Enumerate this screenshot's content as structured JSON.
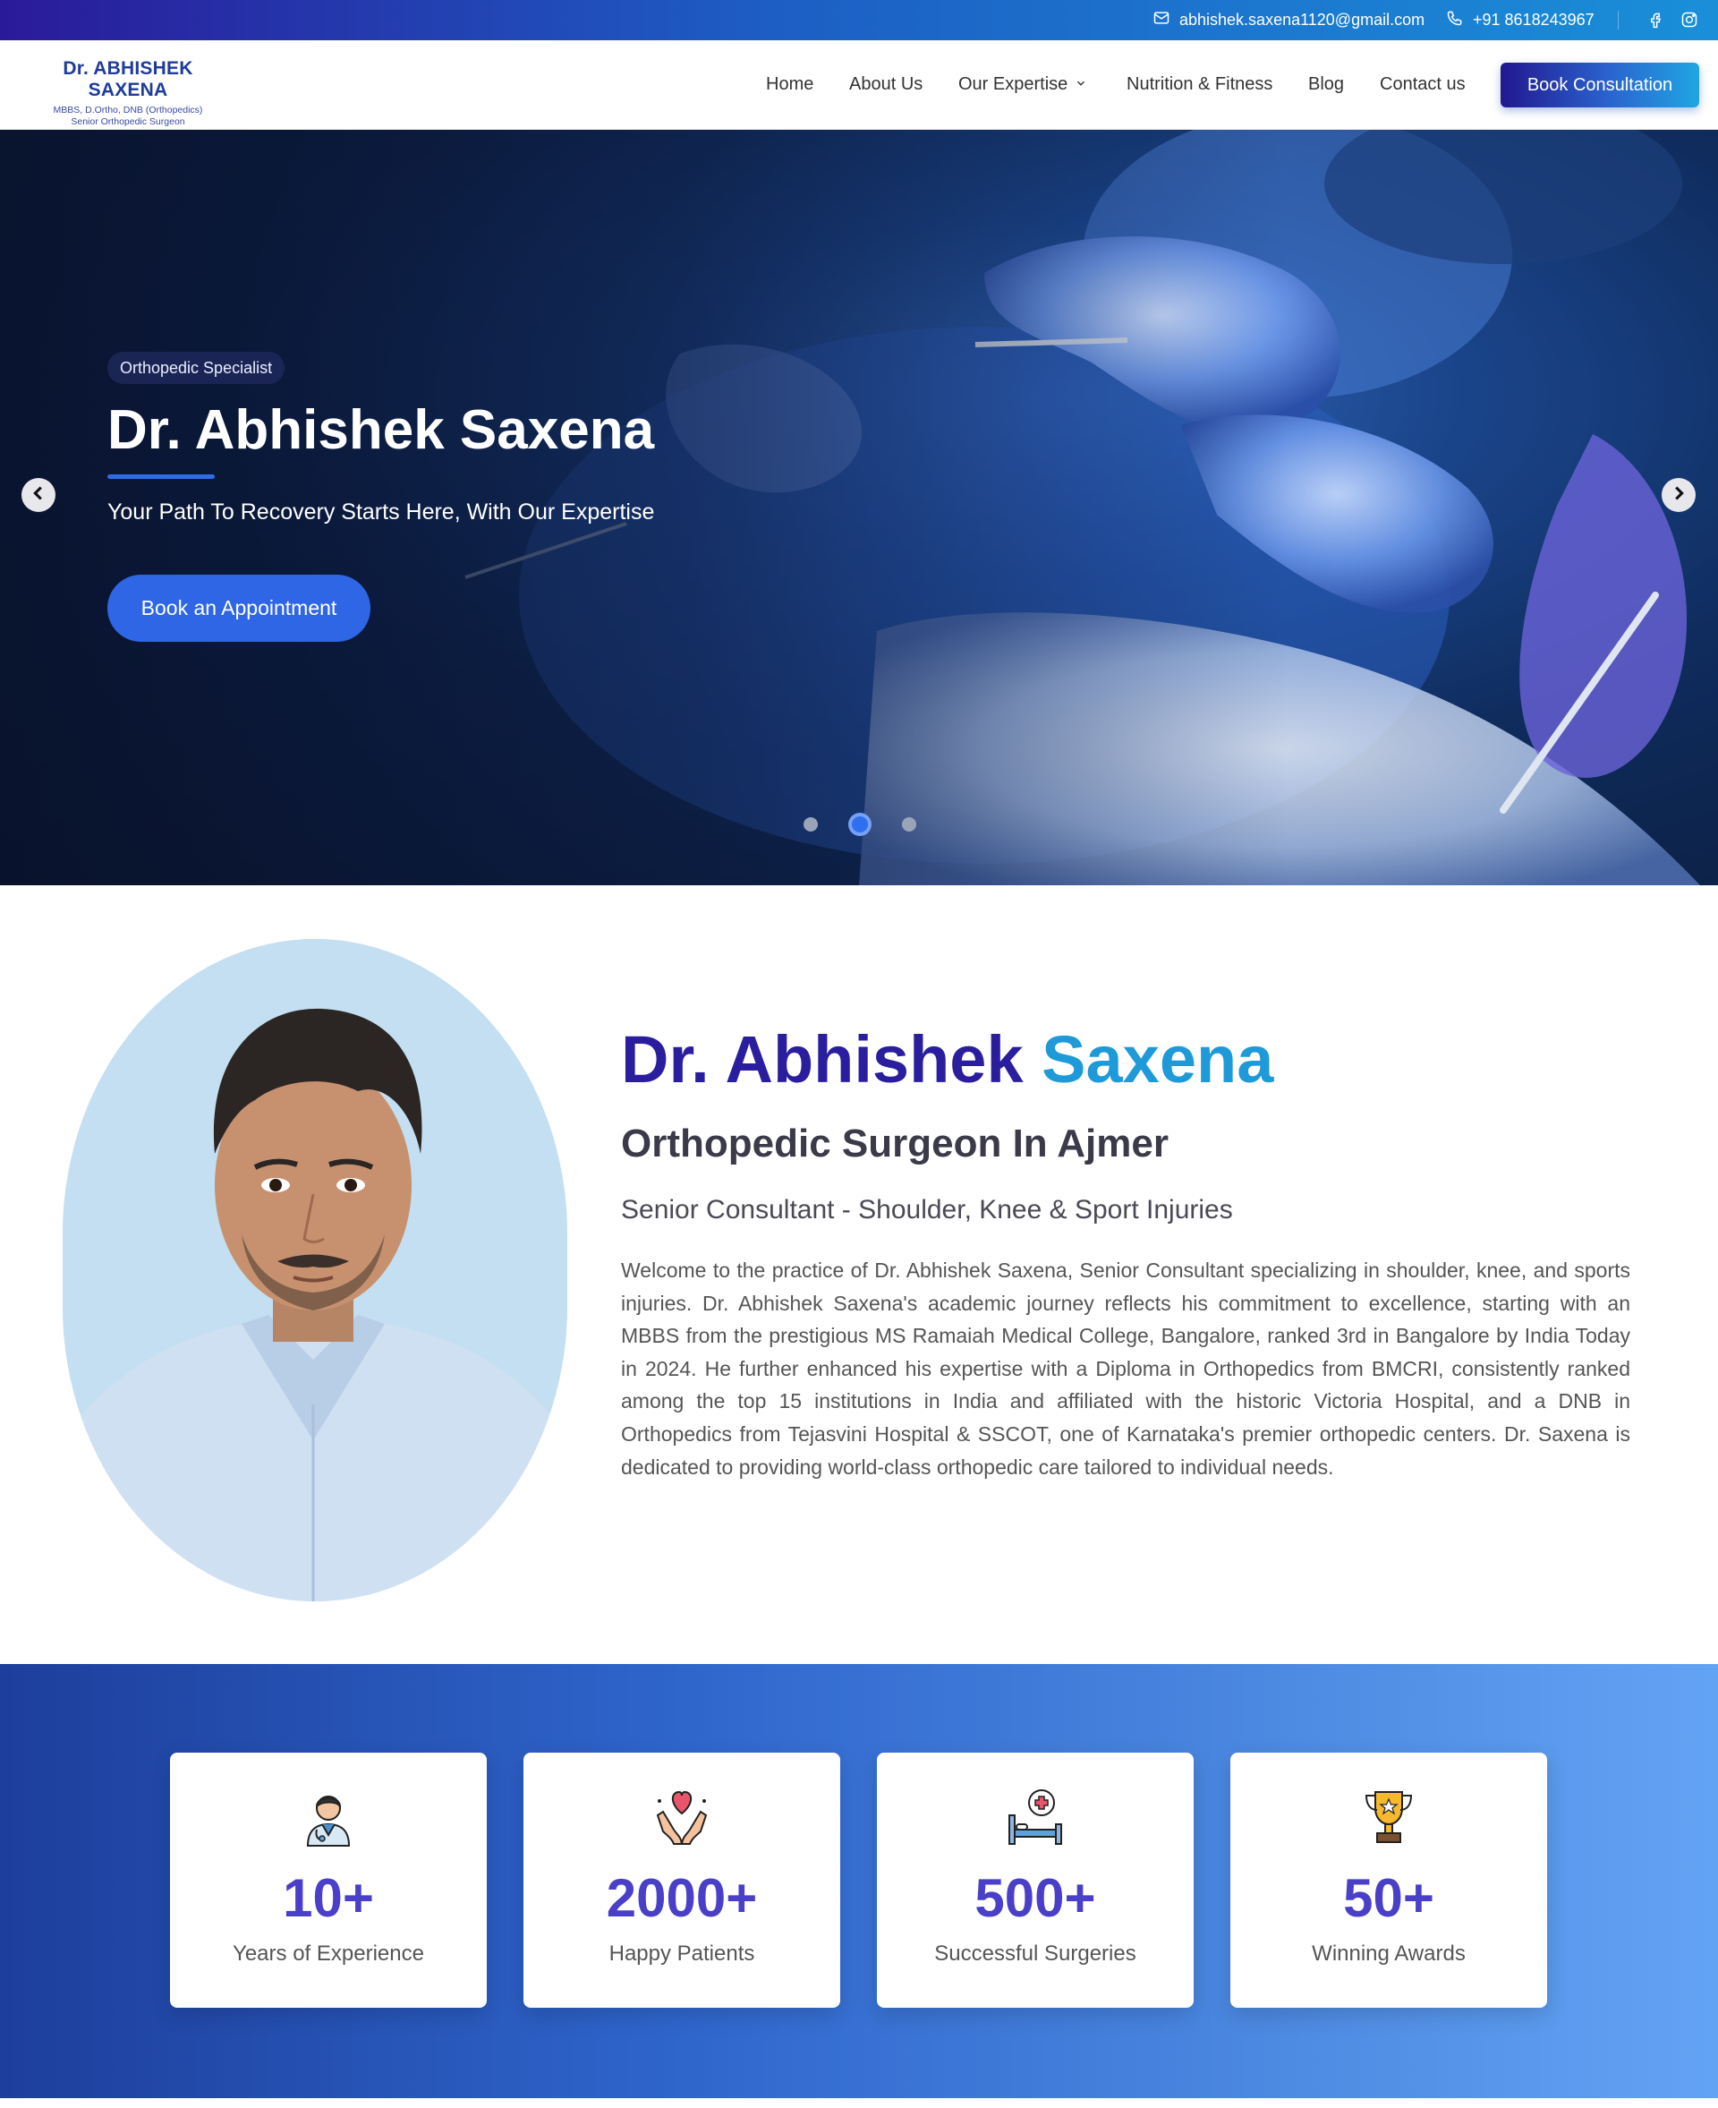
{
  "topbar": {
    "email": "abhishek.saxena1120@gmail.com",
    "phone": "+91 8618243967",
    "social": [
      "facebook-icon",
      "instagram-icon"
    ]
  },
  "logo": {
    "name": "Dr. ABHISHEK SAXENA",
    "qualifications": "MBBS, D.Ortho, DNB (Orthopedics)",
    "designation": "Senior Orthopedic Surgeon"
  },
  "nav": {
    "items": [
      {
        "label": "Home"
      },
      {
        "label": "About Us"
      },
      {
        "label": "Our Expertise",
        "dropdown": true
      },
      {
        "label": "Nutrition & Fitness"
      },
      {
        "label": "Blog"
      },
      {
        "label": "Contact us"
      }
    ],
    "cta": "Book Consultation"
  },
  "hero": {
    "badge": "Orthopedic Specialist",
    "title": "Dr. Abhishek Saxena",
    "subtitle": "Your Path To Recovery Starts Here, With Our Expertise",
    "button": "Book an Appointment",
    "slides_total": 3,
    "active_slide": 2
  },
  "about": {
    "name_first": "Dr. Abhishek",
    "name_last": "Saxena",
    "title": "Orthopedic Surgeon In Ajmer",
    "subtitle": "Senior Consultant - Shoulder, Knee & Sport Injuries",
    "body": "Welcome to the practice of Dr. Abhishek Saxena, Senior Consultant specializing in shoulder, knee, and sports injuries. Dr. Abhishek Saxena's academic journey reflects his commitment to excellence, starting with an MBBS from the prestigious MS Ramaiah Medical College, Bangalore, ranked 3rd in Bangalore by India Today in 2024. He further enhanced his expertise with a Diploma in Orthopedics from BMCRI, consistently ranked among the top 15 institutions in India and affiliated with the historic Victoria Hospital, and a DNB in Orthopedics from Tejasvini Hospital & SSCOT, one of Karnataka's premier orthopedic centers. Dr. Saxena is dedicated to providing world-class orthopedic care tailored to individual needs."
  },
  "stats": [
    {
      "value": "10+",
      "label": "Years of Experience",
      "icon": "doctor-icon"
    },
    {
      "value": "2000+",
      "label": "Happy Patients",
      "icon": "heart-hands-icon"
    },
    {
      "value": "500+",
      "label": "Successful Surgeries",
      "icon": "hospital-bed-icon"
    },
    {
      "value": "50+",
      "label": "Winning Awards",
      "icon": "trophy-icon"
    }
  ],
  "colors": {
    "brand_dark": "#2a1e9e",
    "brand_light": "#1e9ad8",
    "accent_blue": "#2f66e6",
    "stat_value": "#4a3fc8"
  }
}
